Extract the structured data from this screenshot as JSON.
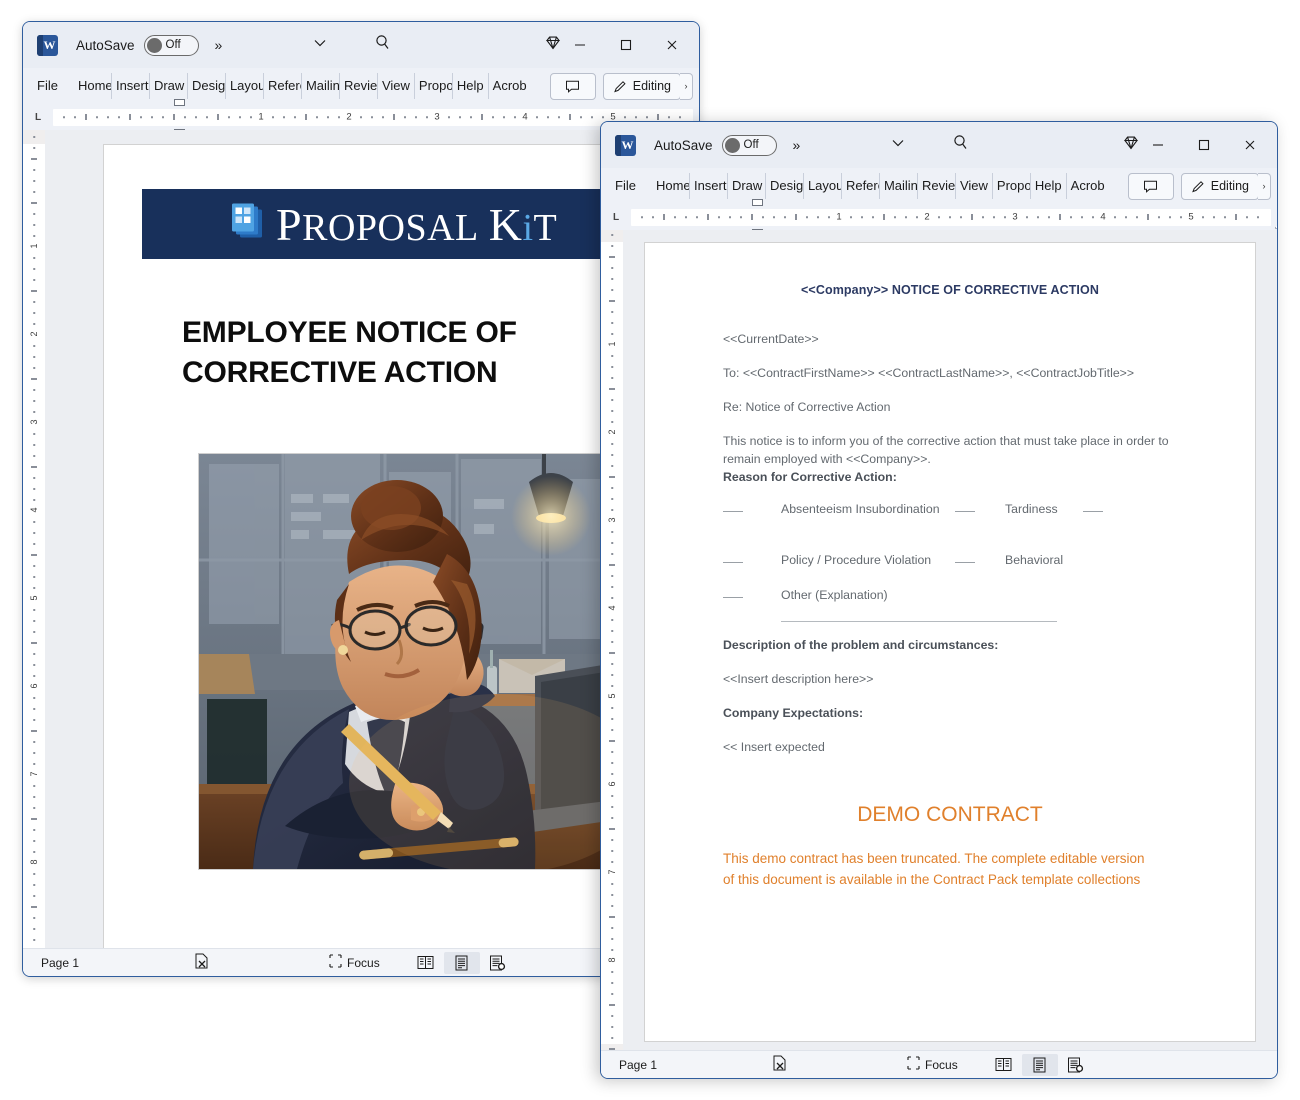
{
  "app": {
    "name": "Microsoft Word",
    "icon": "word-icon",
    "autosave_label": "AutoSave",
    "autosave_state": "Off",
    "more_commands": "»",
    "search_icon": "search-icon",
    "diamond_icon": "diamond-icon",
    "caret_icon": "chevron-down-icon",
    "minimize": "–",
    "maximize": "☐",
    "close": "✕"
  },
  "ribbon": {
    "tabs": [
      {
        "label": "File"
      },
      {
        "label": "Home"
      },
      {
        "label": "Insert"
      },
      {
        "label": "Draw"
      },
      {
        "label": "Design"
      },
      {
        "label": "Layout"
      },
      {
        "label": "References"
      },
      {
        "label": "Mailings"
      },
      {
        "label": "Review"
      },
      {
        "label": "View"
      },
      {
        "label": "Proposal"
      },
      {
        "label": "Help"
      },
      {
        "label": "Acrobat"
      }
    ],
    "comment_button": "comment-icon",
    "editing_button": "Editing",
    "editing_chevron": "›"
  },
  "ruler": {
    "tab_selector": "L",
    "numbers": [
      "1",
      "2",
      "3",
      "4",
      "5"
    ],
    "vertical_numbers": [
      "1",
      "2",
      "3",
      "4",
      "5",
      "6",
      "7",
      "8"
    ]
  },
  "statusbar": {
    "page": "Page 1",
    "proofing_icon": "proofing-errors-icon",
    "focus_label": "Focus",
    "focus_icon": "focus-icon",
    "views": [
      {
        "name": "read-mode-icon",
        "active": false
      },
      {
        "name": "print-layout-icon",
        "active": true
      },
      {
        "name": "web-layout-icon",
        "active": false
      }
    ]
  },
  "window1": {
    "document": {
      "banner_brand_first": "P",
      "banner_brand_rest": "ROPOSAL",
      "banner_brand_k": "K",
      "banner_brand_i": "i",
      "banner_brand_t": "T",
      "banner_color": "#18305b",
      "logo_icon": "proposal-kit-document-stack-icon",
      "heading": "EMPLOYEE NOTICE OF CORRECTIVE ACTION",
      "image_alt": "businesswoman-writing-at-desk-illustration"
    }
  },
  "window2": {
    "document": {
      "title": "<<Company>> NOTICE OF CORRECTIVE ACTION",
      "title_color": "#2c3a63",
      "current_date": "<<CurrentDate>>",
      "to_line": "To: <<ContractFirstName>> <<ContractLastName>>, <<ContractJobTitle>>",
      "re_line": "Re: Notice of Corrective Action",
      "notice_body": "This notice is to inform you of the corrective action that must take place in order to remain employed with <<Company>>.",
      "reason_heading": "Reason for Corrective Action:",
      "reasons": [
        {
          "left": "Absenteeism Insubordination",
          "right": "Tardiness",
          "extra_blank": true
        },
        {
          "left": "Policy / Procedure Violation",
          "right": "Behavioral",
          "extra_blank": false
        },
        {
          "left": "Other (Explanation)",
          "right": "",
          "extra_blank": false
        }
      ],
      "description_heading": "Description of the problem and circumstances:",
      "description_value": "<<Insert description here>>",
      "expectations_heading": "Company Expectations:",
      "expectations_value": "<< Insert expected",
      "demo_heading": "DEMO CONTRACT",
      "demo_body": "This demo contract has been truncated. The complete editable version of this document is available in the Contract Pack template collections",
      "demo_color": "#e0802c"
    }
  }
}
